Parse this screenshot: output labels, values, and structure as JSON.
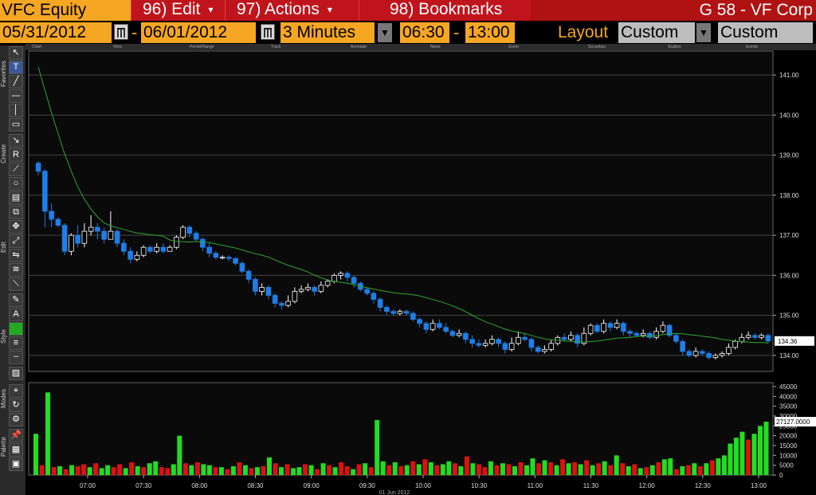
{
  "header": {
    "ticker": "VFC Equity",
    "menus": [
      {
        "label": "96) Edit",
        "caret": "▾"
      },
      {
        "label": "97) Actions",
        "caret": "▾"
      },
      {
        "label": "98) Bookmarks",
        "caret": ""
      }
    ],
    "security_title": "G 58 - VF Corp"
  },
  "controls": {
    "start_date": "05/31/2012",
    "end_date": "06/01/2012",
    "interval": "3 Minutes",
    "start_time": "06:30",
    "end_time": "13:00",
    "layout_label": "Layout",
    "layout_value": "Custom",
    "ccy_value": "Custom CCY"
  },
  "toolbar": {
    "sections": [
      "Favorites",
      "Create",
      "Edit",
      "Style",
      "Modes",
      "Palette"
    ]
  },
  "chart_header_tabs": [
    "Chart",
    "View",
    "Period/Range",
    "Track",
    "Annotate",
    "News",
    "Zoom",
    "Securities",
    "Studies",
    "Events"
  ],
  "colors": {
    "up": "#ffffff",
    "down": "#1e7ee8",
    "ma": "#2ea82e",
    "vol_up": "#22dd22",
    "vol_down": "#dd1111",
    "orange": "#f5a623",
    "red_bar": "#b01212"
  },
  "chart_data": [
    {
      "type": "candlestick",
      "price_axis_labels": [
        "141.00",
        "140.00",
        "139.00",
        "138.00",
        "137.00",
        "136.00",
        "135.00",
        "134.00"
      ],
      "last_price_label": "134.36",
      "ylim": [
        133.6,
        141.6
      ],
      "candles": [
        [
          138.8,
          138.6,
          138.85,
          138.5
        ],
        [
          138.6,
          137.6,
          138.65,
          137.2
        ],
        [
          137.6,
          137.4,
          137.8,
          137.2
        ],
        [
          137.4,
          137.25,
          137.45,
          137.2
        ],
        [
          137.25,
          136.6,
          137.3,
          136.5
        ],
        [
          136.6,
          137.0,
          137.05,
          136.5
        ],
        [
          137.0,
          136.8,
          137.25,
          136.7
        ],
        [
          136.8,
          137.1,
          137.3,
          136.7
        ],
        [
          137.1,
          137.2,
          137.5,
          137.0
        ],
        [
          137.2,
          137.1,
          137.3,
          136.9
        ],
        [
          137.1,
          136.9,
          137.2,
          136.8
        ],
        [
          136.9,
          137.1,
          137.6,
          136.9
        ],
        [
          137.1,
          136.8,
          137.15,
          136.7
        ],
        [
          136.8,
          136.6,
          136.9,
          136.5
        ],
        [
          136.6,
          136.4,
          136.7,
          136.3
        ],
        [
          136.4,
          136.5,
          136.6,
          136.35
        ],
        [
          136.5,
          136.7,
          136.75,
          136.45
        ],
        [
          136.7,
          136.6,
          136.75,
          136.55
        ],
        [
          136.6,
          136.7,
          136.8,
          136.55
        ],
        [
          136.7,
          136.6,
          136.8,
          136.55
        ],
        [
          136.6,
          136.7,
          136.75,
          136.6
        ],
        [
          136.7,
          136.95,
          137.0,
          136.65
        ],
        [
          136.95,
          137.2,
          137.25,
          136.9
        ],
        [
          137.2,
          137.05,
          137.25,
          136.95
        ],
        [
          137.05,
          136.9,
          137.1,
          136.85
        ],
        [
          136.9,
          136.7,
          136.95,
          136.6
        ],
        [
          136.7,
          136.55,
          136.8,
          136.45
        ],
        [
          136.55,
          136.45,
          136.6,
          136.4
        ],
        [
          136.45,
          136.45,
          136.5,
          136.4
        ],
        [
          136.45,
          136.42,
          136.5,
          136.35
        ],
        [
          136.42,
          136.3,
          136.45,
          136.25
        ],
        [
          136.3,
          136.1,
          136.35,
          136.05
        ],
        [
          136.1,
          135.9,
          136.15,
          135.8
        ],
        [
          135.9,
          135.6,
          135.95,
          135.5
        ],
        [
          135.6,
          135.7,
          135.8,
          135.5
        ],
        [
          135.7,
          135.5,
          135.75,
          135.4
        ],
        [
          135.5,
          135.3,
          135.55,
          135.2
        ],
        [
          135.3,
          135.25,
          135.35,
          135.15
        ],
        [
          135.25,
          135.35,
          135.5,
          135.2
        ],
        [
          135.35,
          135.6,
          135.7,
          135.3
        ],
        [
          135.6,
          135.65,
          135.75,
          135.55
        ],
        [
          135.65,
          135.7,
          135.8,
          135.6
        ],
        [
          135.7,
          135.6,
          135.75,
          135.5
        ],
        [
          135.6,
          135.75,
          135.85,
          135.55
        ],
        [
          135.75,
          135.85,
          135.9,
          135.7
        ],
        [
          135.85,
          136.0,
          136.05,
          135.8
        ],
        [
          136.0,
          136.05,
          136.1,
          135.9
        ],
        [
          136.05,
          135.95,
          136.1,
          135.85
        ],
        [
          135.95,
          135.8,
          136.0,
          135.7
        ],
        [
          135.8,
          135.65,
          135.85,
          135.6
        ],
        [
          135.65,
          135.55,
          135.7,
          135.5
        ],
        [
          135.55,
          135.4,
          135.6,
          135.3
        ],
        [
          135.4,
          135.2,
          135.45,
          135.1
        ],
        [
          135.2,
          135.1,
          135.25,
          135.0
        ],
        [
          135.1,
          135.05,
          135.15,
          135.0
        ],
        [
          135.05,
          135.1,
          135.15,
          135.0
        ],
        [
          135.1,
          135.05,
          135.15,
          135.0
        ],
        [
          135.05,
          134.9,
          135.1,
          134.85
        ],
        [
          134.9,
          134.8,
          134.95,
          134.7
        ],
        [
          134.8,
          134.65,
          134.85,
          134.55
        ],
        [
          134.65,
          134.8,
          134.9,
          134.6
        ],
        [
          134.8,
          134.7,
          134.9,
          134.65
        ],
        [
          134.7,
          134.6,
          134.8,
          134.55
        ],
        [
          134.6,
          134.5,
          134.65,
          134.45
        ],
        [
          134.5,
          134.55,
          134.65,
          134.45
        ],
        [
          134.55,
          134.4,
          134.6,
          134.3
        ],
        [
          134.4,
          134.3,
          134.5,
          134.2
        ],
        [
          134.3,
          134.25,
          134.4,
          134.2
        ],
        [
          134.25,
          134.3,
          134.4,
          134.2
        ],
        [
          134.3,
          134.4,
          134.5,
          134.25
        ],
        [
          134.4,
          134.3,
          134.45,
          134.2
        ],
        [
          134.3,
          134.15,
          134.35,
          134.05
        ],
        [
          134.15,
          134.3,
          134.45,
          134.1
        ],
        [
          134.3,
          134.45,
          134.6,
          134.25
        ],
        [
          134.45,
          134.4,
          134.55,
          134.35
        ],
        [
          134.4,
          134.2,
          134.45,
          134.1
        ],
        [
          134.2,
          134.1,
          134.25,
          134.05
        ],
        [
          134.1,
          134.15,
          134.25,
          134.05
        ],
        [
          134.15,
          134.3,
          134.4,
          134.1
        ],
        [
          134.3,
          134.45,
          134.5,
          134.25
        ],
        [
          134.45,
          134.4,
          134.55,
          134.35
        ],
        [
          134.4,
          134.5,
          134.6,
          134.35
        ],
        [
          134.5,
          134.3,
          134.55,
          134.2
        ],
        [
          134.3,
          134.55,
          134.7,
          134.25
        ],
        [
          134.55,
          134.75,
          134.8,
          134.5
        ],
        [
          134.75,
          134.6,
          134.8,
          134.55
        ],
        [
          134.6,
          134.8,
          134.9,
          134.55
        ],
        [
          134.8,
          134.7,
          134.85,
          134.6
        ],
        [
          134.7,
          134.8,
          134.9,
          134.65
        ],
        [
          134.8,
          134.6,
          134.85,
          134.5
        ],
        [
          134.6,
          134.55,
          134.65,
          134.45
        ],
        [
          134.55,
          134.5,
          134.6,
          134.45
        ],
        [
          134.5,
          134.55,
          134.65,
          134.45
        ],
        [
          134.55,
          134.45,
          134.6,
          134.4
        ],
        [
          134.45,
          134.6,
          134.7,
          134.4
        ],
        [
          134.6,
          134.75,
          134.85,
          134.55
        ],
        [
          134.75,
          134.5,
          134.8,
          134.45
        ],
        [
          134.5,
          134.35,
          134.55,
          134.3
        ],
        [
          134.35,
          134.1,
          134.4,
          134.0
        ],
        [
          134.1,
          134.0,
          134.15,
          133.95
        ],
        [
          134.0,
          134.1,
          134.2,
          133.95
        ],
        [
          134.1,
          134.05,
          134.15,
          134.0
        ],
        [
          134.05,
          133.95,
          134.1,
          133.9
        ],
        [
          133.95,
          134.0,
          134.05,
          133.9
        ],
        [
          134.0,
          134.05,
          134.1,
          133.95
        ],
        [
          134.05,
          134.2,
          134.3,
          134.0
        ],
        [
          134.2,
          134.35,
          134.4,
          134.15
        ],
        [
          134.35,
          134.45,
          134.55,
          134.3
        ],
        [
          134.45,
          134.5,
          134.6,
          134.4
        ],
        [
          134.5,
          134.45,
          134.55,
          134.4
        ],
        [
          134.45,
          134.5,
          134.55,
          134.4
        ],
        [
          134.5,
          134.36,
          134.55,
          134.3
        ]
      ]
    },
    {
      "type": "bar",
      "volume_axis_labels": [
        "45000",
        "40000",
        "35000",
        "30000",
        "25000",
        "20000",
        "15000",
        "10000",
        "5000",
        "0"
      ],
      "last_volume_label": "27127.0000",
      "ylim": [
        0,
        47000
      ],
      "values": [
        21000,
        5000,
        42000,
        4000,
        4500,
        3000,
        5000,
        4500,
        5500,
        4000,
        6000,
        3500,
        5000,
        4000,
        5500,
        3500,
        6500,
        4500,
        4000,
        6000,
        7000,
        4000,
        3500,
        5500,
        20000,
        6000,
        5000,
        6500,
        5500,
        5000,
        4000,
        4000,
        3000,
        4500,
        6500,
        5000,
        3500,
        4000,
        4500,
        9000,
        6000,
        4000,
        5500,
        3500,
        4000,
        5500,
        5000,
        3000,
        6000,
        5000,
        4000,
        6500,
        4500,
        3000,
        5500,
        6000,
        4000,
        28000,
        7000,
        5000,
        6500,
        4500,
        5000,
        7000,
        5500,
        8000,
        6500,
        5000,
        5500,
        7000,
        6000,
        4500,
        9500,
        6000,
        5500,
        4000,
        7000,
        5000,
        6000,
        5500,
        4500,
        6500,
        5000,
        8500,
        6000,
        7500,
        6500,
        5000,
        8000,
        6000,
        6500,
        5500,
        7500,
        5000,
        6000,
        7000,
        5000,
        10000,
        6000,
        4500,
        5500,
        3500,
        4000,
        5000,
        6500,
        8000,
        8500,
        3000,
        4500,
        5000,
        6000,
        4500,
        6000,
        7500,
        8500,
        10000,
        16000,
        19000,
        22000,
        18000,
        21000,
        25000,
        27127
      ],
      "colors_up": [
        true,
        false,
        true,
        false,
        true,
        false,
        true,
        false,
        false,
        true,
        false,
        true,
        true,
        false,
        false,
        true,
        false,
        true,
        false,
        true,
        true,
        false,
        false,
        true,
        true,
        false,
        true,
        false,
        true,
        true,
        false,
        true,
        false,
        true,
        false,
        true,
        false,
        true,
        false,
        true,
        false,
        true,
        false,
        true,
        true,
        false,
        true,
        false,
        true,
        false,
        true,
        false,
        false,
        true,
        false,
        true,
        false,
        true,
        true,
        false,
        true,
        false,
        true,
        false,
        true,
        false,
        true,
        false,
        true,
        true,
        false,
        true,
        false,
        true,
        false,
        false,
        true,
        false,
        true,
        false,
        true,
        false,
        true,
        true,
        false,
        true,
        false,
        true,
        false,
        true,
        false,
        true,
        false,
        true,
        false,
        true,
        false,
        true,
        false,
        true,
        false,
        true,
        false,
        true,
        false,
        true,
        true,
        false,
        true,
        false,
        true,
        false,
        true,
        false,
        true,
        true,
        true,
        true,
        true,
        false,
        true,
        true,
        true
      ],
      "x_tick_labels": [
        "07:00",
        "07:30",
        "08:00",
        "08:30",
        "09:00",
        "09:30",
        "10:00",
        "10:30",
        "11:00",
        "11:30",
        "12:00",
        "12:30",
        "13:00"
      ],
      "x_date_label": "01 Jun 2012"
    }
  ]
}
